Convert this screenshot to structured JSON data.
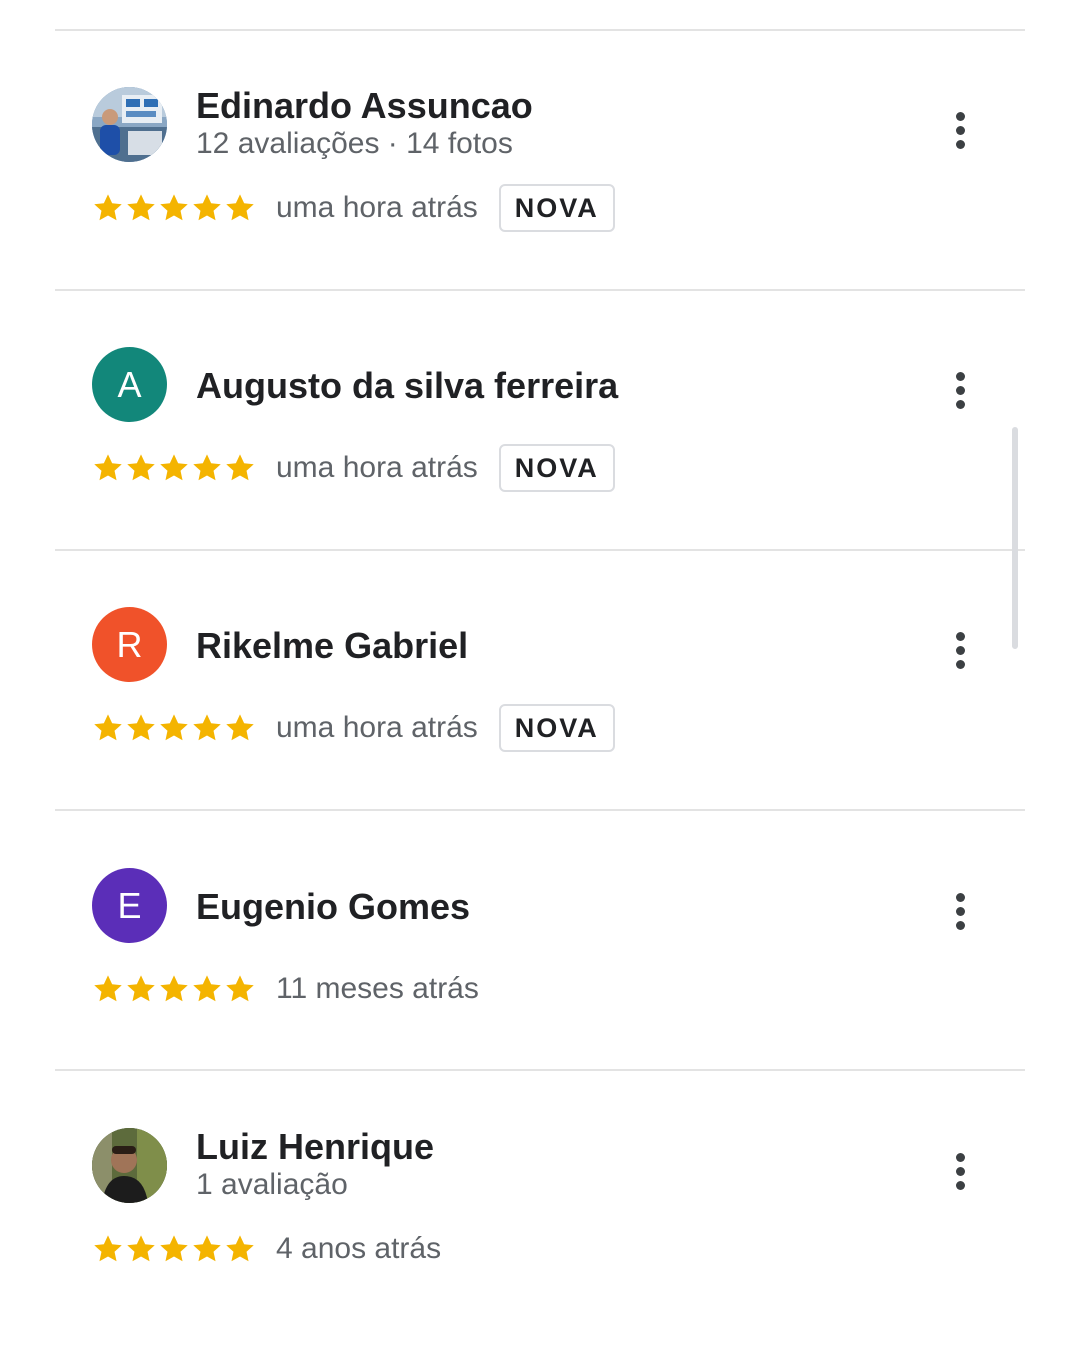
{
  "colors": {
    "star": "#f4b400",
    "avatar_a": "#12877a",
    "avatar_r": "#f0522a",
    "avatar_e": "#5b2eb8"
  },
  "reviews": [
    {
      "name": "Edinardo Assuncao",
      "subline": "12 avaliações · 14 fotos",
      "avatar_type": "photo",
      "rating": 5,
      "time": "uma hora atrás",
      "badge": "NOVA"
    },
    {
      "name": "Augusto da silva ferreira",
      "avatar_letter": "A",
      "avatar_type": "letter",
      "rating": 5,
      "time": "uma hora atrás",
      "badge": "NOVA"
    },
    {
      "name": "Rikelme Gabriel",
      "avatar_letter": "R",
      "avatar_type": "letter",
      "rating": 5,
      "time": "uma hora atrás",
      "badge": "NOVA"
    },
    {
      "name": "Eugenio Gomes",
      "avatar_letter": "E",
      "avatar_type": "letter",
      "rating": 5,
      "time": "11 meses atrás"
    },
    {
      "name": "Luiz Henrique",
      "subline": "1 avaliação",
      "avatar_type": "photo",
      "rating": 5,
      "time": "4 anos atrás"
    }
  ],
  "icons": {
    "more": "more-vert-icon",
    "star": "star-icon"
  }
}
